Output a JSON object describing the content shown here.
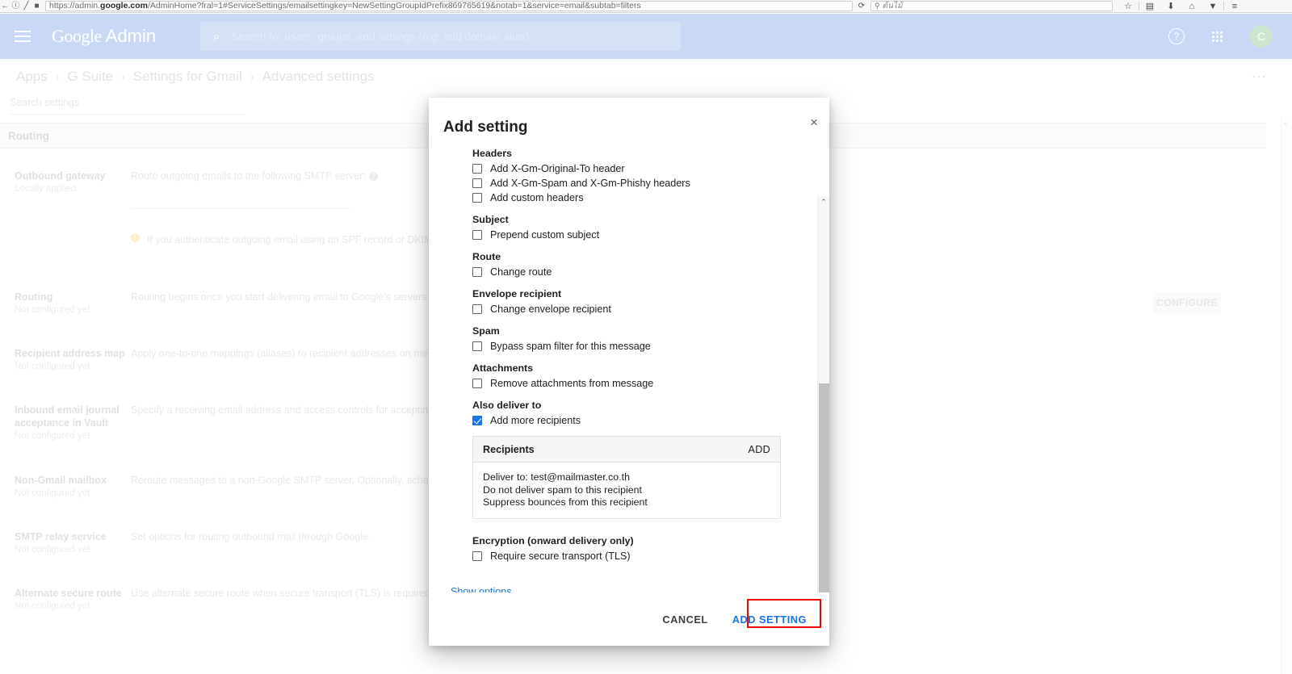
{
  "browser": {
    "url_prefix": "https://admin.",
    "url_bold": "google.com",
    "url_suffix": "/AdminHome?fral=1#ServiceSettings/emailsettingkey=NewSettingGroupIdPrefix869765619&notab=1&service=email&subtab=filters",
    "search_value": "ต้นไม้",
    "reload_icon": "⟳",
    "back_icon": "←",
    "info_icon": "ⓘ",
    "shield_icon": "✓",
    "bookmark_icon": "☆",
    "library_icon": "▤",
    "download_icon": "⬇",
    "home_icon": "⌂",
    "pocket_icon": "▼",
    "menu_icon": "≡"
  },
  "header": {
    "brand_google": "Google",
    "brand_admin": "Admin",
    "search_placeholder": "Search for users, groups, and settings (e.g. add domain alias)",
    "search_icon": "⌕",
    "help_icon": "?",
    "avatar_letter": "C"
  },
  "breadcrumb": {
    "items": [
      "Apps",
      "G Suite",
      "Settings for Gmail",
      "Advanced settings"
    ],
    "separator": "›",
    "overflow_icon": "⋮"
  },
  "settings_search": {
    "placeholder": "Search settings"
  },
  "section": {
    "title": "Routing"
  },
  "rows": [
    {
      "name": "Outbound gateway",
      "status": "Locally applied",
      "desc": "Route outgoing emails to the following SMTP server:",
      "help_icon": "?",
      "warning": "If you authenticate outgoing email using an SPF record or DKIM, you may",
      "warning_icon": "!"
    },
    {
      "name": "Routing",
      "status": "Not configured yet",
      "desc": "Routing begins once you start delivering email to Google's servers."
    },
    {
      "name": "Recipient address map",
      "status": "Not configured yet",
      "desc": "Apply one-to-one mappings (aliases) to recipient addresses on messages rec"
    },
    {
      "name": "Inbound email journal acceptance in Vault",
      "status": "Not configured yet",
      "desc": "Specify a receiving email address and access controls for accepting journal m"
    },
    {
      "name": "Non-Gmail mailbox",
      "status": "Not configured yet",
      "desc": "Reroute messages to a non-Google SMTP server. Optionally, schedule periodi"
    },
    {
      "name": "SMTP relay service",
      "status": "Not configured yet",
      "desc": "Set options for routing outbound mail through Google."
    },
    {
      "name": "Alternate secure route",
      "status": "Not configured yet",
      "desc": "Use alternate secure route when secure transport (TLS) is required."
    }
  ],
  "configure_button": "CONFIGURE",
  "dialog": {
    "title": "Add setting",
    "close_icon": "×",
    "scroll_up_icon": "⌃",
    "scroll_down_icon": "⌄",
    "groups": [
      {
        "title": "Headers",
        "options": [
          {
            "label": "Add X-Gm-Original-To header",
            "checked": false
          },
          {
            "label": "Add X-Gm-Spam and X-Gm-Phishy headers",
            "checked": false
          },
          {
            "label": "Add custom headers",
            "checked": false
          }
        ]
      },
      {
        "title": "Subject",
        "options": [
          {
            "label": "Prepend custom subject",
            "checked": false
          }
        ]
      },
      {
        "title": "Route",
        "options": [
          {
            "label": "Change route",
            "checked": false
          }
        ]
      },
      {
        "title": "Envelope recipient",
        "options": [
          {
            "label": "Change envelope recipient",
            "checked": false
          }
        ]
      },
      {
        "title": "Spam",
        "options": [
          {
            "label": "Bypass spam filter for this message",
            "checked": false
          }
        ]
      },
      {
        "title": "Attachments",
        "options": [
          {
            "label": "Remove attachments from message",
            "checked": false
          }
        ]
      },
      {
        "title": "Also deliver to",
        "options": [
          {
            "label": "Add more recipients",
            "checked": true
          }
        ]
      }
    ],
    "recipients": {
      "header": "Recipients",
      "add_label": "ADD",
      "lines": [
        "Deliver to: test@mailmaster.co.th",
        "Do not deliver spam to this recipient",
        "Suppress bounces from this recipient"
      ]
    },
    "encryption": {
      "title": "Encryption (onward delivery only)",
      "options": [
        {
          "label": "Require secure transport (TLS)",
          "checked": false
        }
      ]
    },
    "show_options": "Show options",
    "cancel_label": "CANCEL",
    "submit_label": "ADD SETTING"
  },
  "colors": {
    "accent_blue": "#1a73e8",
    "header_blue": "#c9d8f5",
    "highlight_red": "#ff0000"
  }
}
